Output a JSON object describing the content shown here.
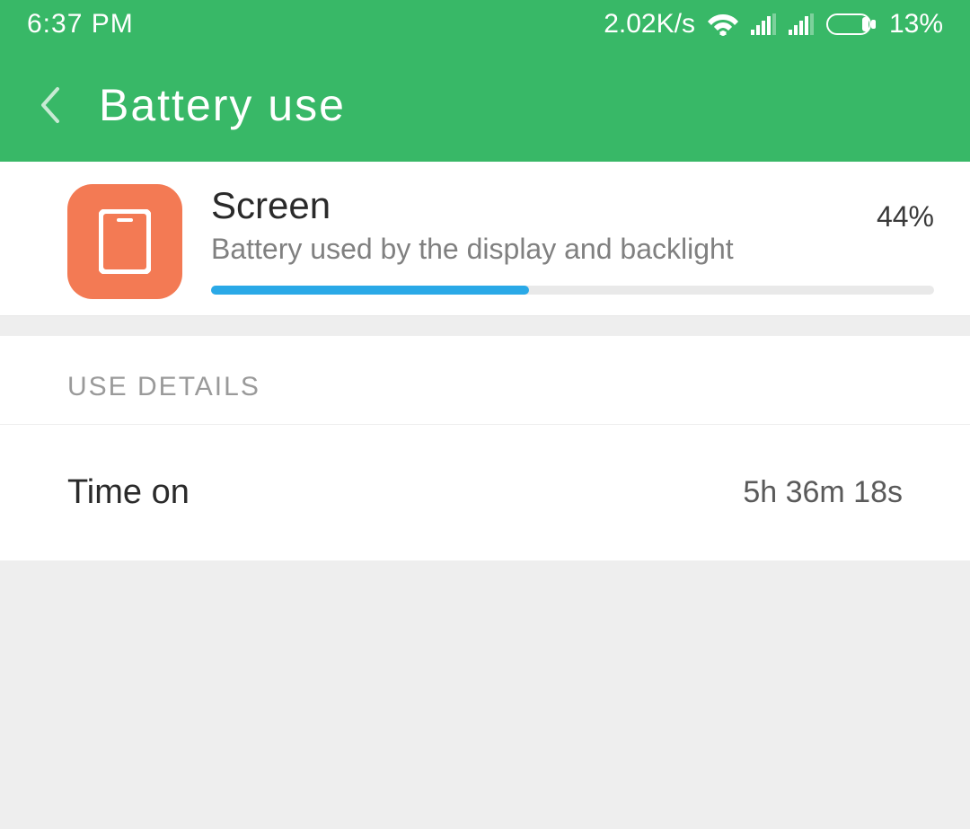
{
  "status": {
    "time": "6:37 PM",
    "speed": "2.02K/s",
    "battery_pct": "13%"
  },
  "header": {
    "title": "Battery use"
  },
  "summary": {
    "title": "Screen",
    "desc": "Battery used by the display and backlight",
    "pct_label": "44%",
    "pct_value": 44
  },
  "details": {
    "section_label": "USE DETAILS",
    "rows": [
      {
        "label": "Time on",
        "value": "5h 36m 18s"
      }
    ]
  }
}
